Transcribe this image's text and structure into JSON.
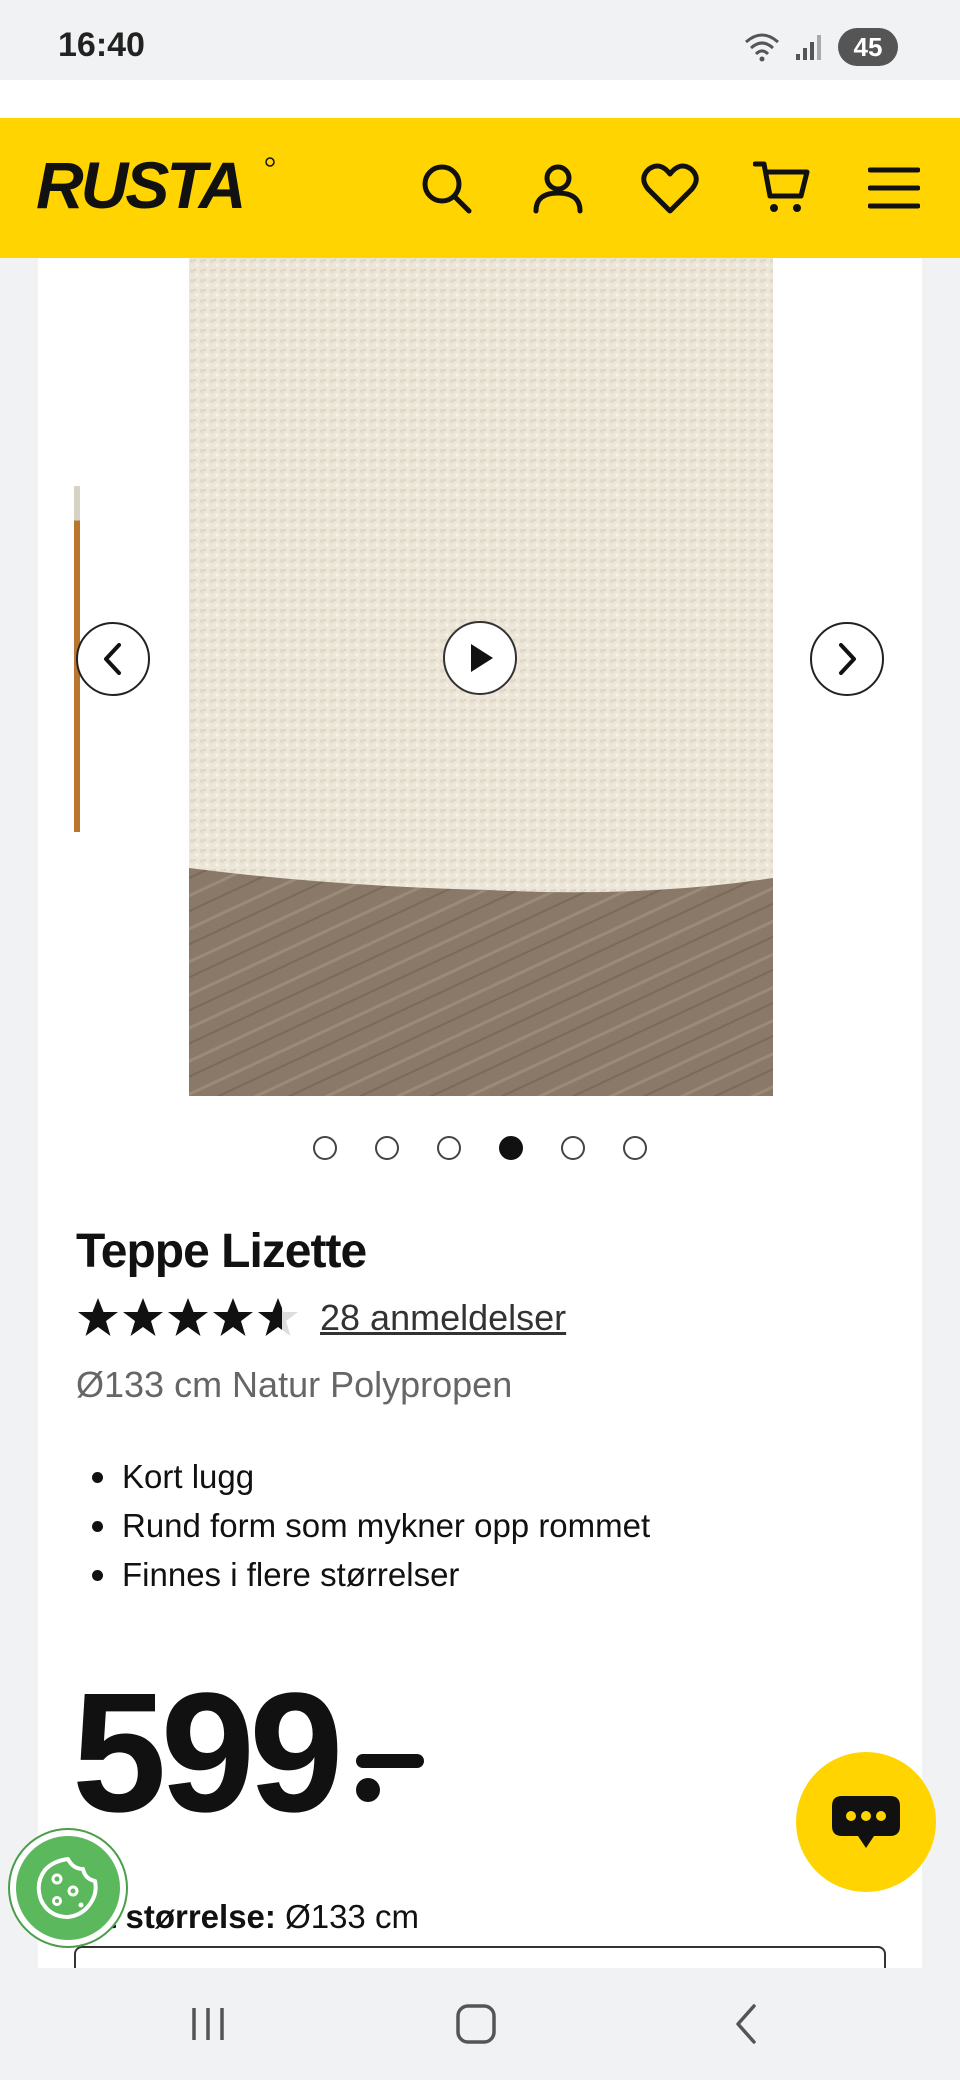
{
  "status_bar": {
    "time": "16:40",
    "battery": "45"
  },
  "header": {
    "logo": "RUSTA",
    "icons": [
      "search-icon",
      "account-icon",
      "heart-icon",
      "cart-icon",
      "menu-icon"
    ],
    "brand_color": "#ffd400"
  },
  "gallery": {
    "active_index": 3,
    "total": 6
  },
  "product": {
    "title": "Teppe Lizette",
    "rating": 4.6,
    "rating_max": 5,
    "reviews": "28 anmeldelser",
    "variant": "Ø133 cm Natur Polypropen",
    "features": [
      "Kort lugg",
      "Rund form som mykner opp rommet",
      "Finnes i flere størrelser"
    ],
    "price": "599",
    "size_label": "lgt størrelse:",
    "size_value": "Ø133 cm"
  },
  "system_nav": {
    "icons": [
      "recent-apps-icon",
      "home-icon",
      "back-icon"
    ]
  }
}
